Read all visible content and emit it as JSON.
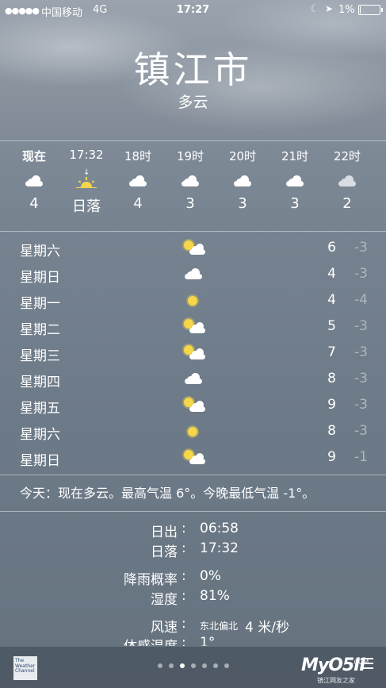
{
  "status_bar": {
    "signal": "●●●●●",
    "carrier": "中国移动",
    "network": "4G",
    "time": "17:27",
    "battery": "1%",
    "battery_level": 0.01
  },
  "header": {
    "city": "镇江市",
    "condition": "多云"
  },
  "hourly": [
    {
      "label": "现在",
      "icon": "cloud-icon",
      "value": "4"
    },
    {
      "label": "17:32",
      "icon": "sunset-icon",
      "value": "日落"
    },
    {
      "label": "18时",
      "icon": "cloud-icon",
      "value": "4"
    },
    {
      "label": "19时",
      "icon": "cloud-icon",
      "value": "3"
    },
    {
      "label": "20时",
      "icon": "cloud-icon",
      "value": "3"
    },
    {
      "label": "21时",
      "icon": "cloud-icon",
      "value": "3"
    },
    {
      "label": "22时",
      "icon": "cloud-icon",
      "value": "2"
    }
  ],
  "daily": [
    {
      "day": "星期六",
      "icon": "partly-cloudy-icon",
      "high": "6",
      "low": "-3"
    },
    {
      "day": "星期日",
      "icon": "cloud-icon",
      "high": "4",
      "low": "-3"
    },
    {
      "day": "星期一",
      "icon": "sun-icon",
      "high": "4",
      "low": "-4"
    },
    {
      "day": "星期二",
      "icon": "partly-cloudy-icon",
      "high": "5",
      "low": "-3"
    },
    {
      "day": "星期三",
      "icon": "partly-cloudy-icon",
      "high": "7",
      "low": "-3"
    },
    {
      "day": "星期四",
      "icon": "cloud-icon",
      "high": "8",
      "low": "-3"
    },
    {
      "day": "星期五",
      "icon": "partly-cloudy-icon",
      "high": "9",
      "low": "-3"
    },
    {
      "day": "星期六",
      "icon": "sun-icon",
      "high": "8",
      "low": "-3"
    },
    {
      "day": "星期日",
      "icon": "partly-cloudy-icon",
      "high": "9",
      "low": "-1"
    }
  ],
  "today_summary": "今天：现在多云。最高气温 6°。今晚最低气温 -1°。",
  "details": {
    "sunrise_label": "日出",
    "sunrise": "06:58",
    "sunset_label": "日落",
    "sunset": "17:32",
    "rain_label": "降雨概率",
    "rain": "0%",
    "humidity_label": "湿度",
    "humidity": "81%",
    "wind_label": "风速",
    "wind_dir": "东北偏北",
    "wind_speed": "4 米/秒",
    "feels_label": "体感温度",
    "feels": "1°"
  },
  "bottom": {
    "logo_text": "The Weather Channel",
    "page_count": 7,
    "active_page": 2,
    "watermark": "MyO5II",
    "watermark_com": ".COM",
    "watermark_sub": "镇江网友之家"
  }
}
